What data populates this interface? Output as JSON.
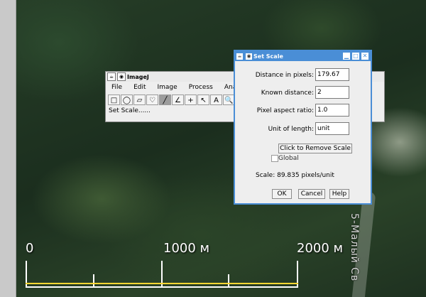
{
  "map": {
    "road_label": "5-Малый Св",
    "scale": {
      "zero": "0",
      "mid": "1000 м",
      "end": "2000 м"
    }
  },
  "imagej": {
    "title": "ImageJ",
    "menu": [
      "File",
      "Edit",
      "Image",
      "Process",
      "Ana"
    ],
    "tools": [
      "rectangle-tool",
      "oval-tool",
      "polygon-tool",
      "freehand-tool",
      "straight-line-tool",
      "angle-tool",
      "point-tool",
      "wand-tool",
      "text-tool",
      "zoom-tool"
    ],
    "tool_glyphs": [
      "□",
      "◯",
      "▱",
      "♡",
      "╱",
      "∠",
      "+",
      "↖",
      "A",
      "🔍"
    ],
    "status": "Set Scale......"
  },
  "set_scale": {
    "title": "Set Scale",
    "distance_label": "Distance in pixels:",
    "distance_value": "179.67",
    "known_label": "Known distance:",
    "known_value": "2",
    "aspect_label": "Pixel aspect ratio:",
    "aspect_value": "1.0",
    "unit_label": "Unit of length:",
    "unit_value": "unit",
    "remove_scale_button": "Click to Remove Scale",
    "global_label": "Global",
    "scale_text": "Scale: 89.835 pixels/unit",
    "ok": "OK",
    "cancel": "Cancel",
    "help": "Help"
  },
  "colors": {
    "title_active": "#4a8ed6",
    "scale_yellow": "#ffd633"
  }
}
